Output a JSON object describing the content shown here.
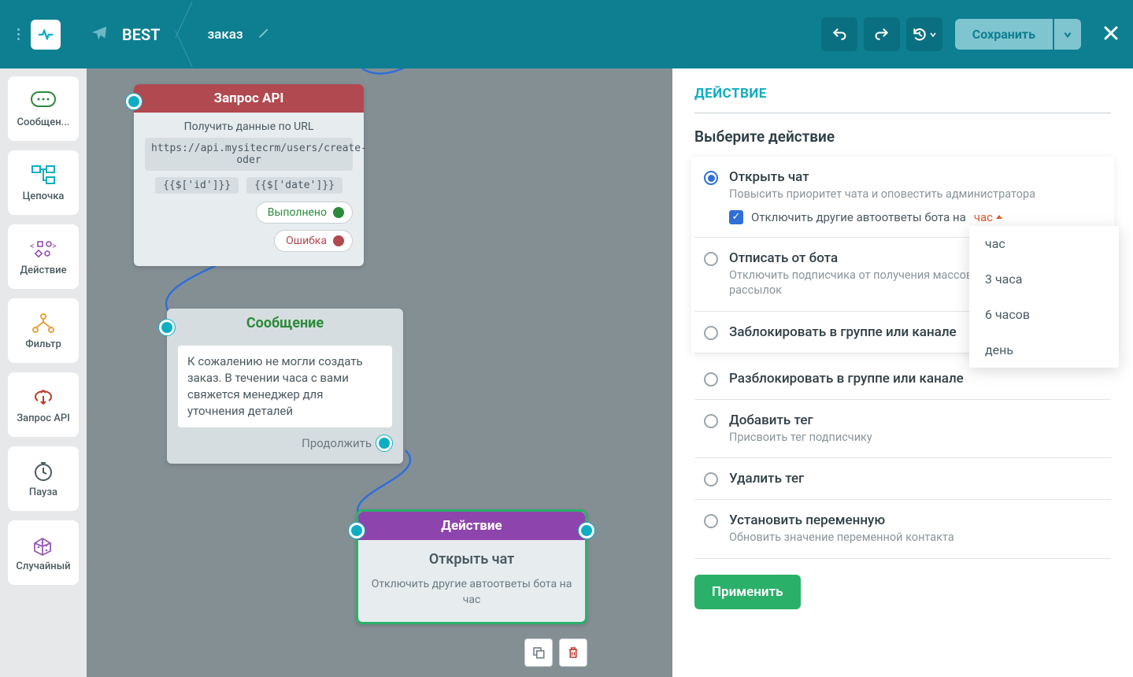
{
  "header": {
    "bot_name": "BEST",
    "flow_name": "заказ",
    "save_label": "Сохранить"
  },
  "sidebar": {
    "items": [
      {
        "label": "Сообщен..."
      },
      {
        "label": "Цепочка"
      },
      {
        "label": "Действие"
      },
      {
        "label": "Фильтр"
      },
      {
        "label": "Запрос API"
      },
      {
        "label": "Пауза"
      },
      {
        "label": "Случайный"
      }
    ]
  },
  "nodes": {
    "api": {
      "title": "Запрос API",
      "subtitle": "Получить данные по URL",
      "url": "https://api.mysitecrm/users/create-oder",
      "param1": "{{$['id']}}",
      "param2": "{{$['date']}}",
      "pill_success": "Выполнено",
      "pill_error": "Ошибка"
    },
    "msg": {
      "title": "Сообщение",
      "text": "К сожалению не могли создать заказ. В течении часа с вами свяжется менеджер для уточнения деталей",
      "continue": "Продолжить"
    },
    "action": {
      "title": "Действие",
      "heading": "Открыть чат",
      "sub": "Отключить другие автоответы бота на  час"
    }
  },
  "panel": {
    "title": "ДЕЙСТВИЕ",
    "select_label": "Выберите действие",
    "options": [
      {
        "label": "Открыть чат",
        "desc": "Повысить приоритет чата и оповестить администратора",
        "selected": true,
        "check_text": "Отключить другие автоответы бота на",
        "hour_label": "час"
      },
      {
        "label": "Отписать от бота",
        "desc": "Отключить подписчика от получения массовых и автоматических рассылок"
      },
      {
        "label": "Заблокировать в группе или канале"
      },
      {
        "label": "Разблокировать в группе или канале"
      },
      {
        "label": "Добавить тег",
        "desc": "Присвоить тег подписчику"
      },
      {
        "label": "Удалить тег"
      },
      {
        "label": "Установить переменную",
        "desc": "Обновить значение переменной контакта"
      }
    ],
    "dropdown": [
      "час",
      "3 часа",
      "6 часов",
      "день"
    ],
    "apply_label": "Применить"
  }
}
